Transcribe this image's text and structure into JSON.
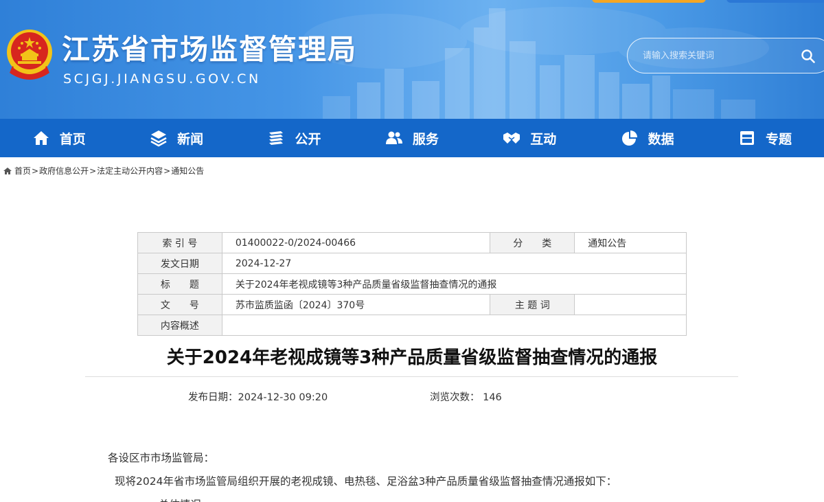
{
  "header": {
    "title": "江苏省市场监督管理局",
    "url": "SCJGJ.JIANGSU.GOV.CN",
    "search": {
      "placeholder": "请输入搜索关键词"
    }
  },
  "nav": {
    "items": [
      {
        "label": "首页",
        "icon": "home-icon"
      },
      {
        "label": "新闻",
        "icon": "layers-icon"
      },
      {
        "label": "公开",
        "icon": "books-icon"
      },
      {
        "label": "服务",
        "icon": "people-icon"
      },
      {
        "label": "互动",
        "icon": "handshake-icon"
      },
      {
        "label": "数据",
        "icon": "pie-chart-icon"
      },
      {
        "label": "专题",
        "icon": "window-icon"
      }
    ]
  },
  "breadcrumb": {
    "items": [
      "首页",
      "政府信息公开",
      "法定主动公开内容",
      "通知公告"
    ],
    "separator": ">"
  },
  "info": {
    "index_label": "索 引 号",
    "index_value": "01400022-0/2024-00466",
    "category_label": "分　　类",
    "category_value": "通知公告",
    "date_label": "发文日期",
    "date_value": "2024-12-27",
    "title_label": "标　　题",
    "title_value": "关于2024年老视成镜等3种产品质量省级监督抽查情况的通报",
    "docno_label": "文　　号",
    "docno_value": "苏市监质监函〔2024〕370号",
    "keywords_label": "主 题 词",
    "keywords_value": "",
    "summary_label": "内容概述",
    "summary_value": ""
  },
  "article": {
    "title": "关于2024年老视成镜等3种产品质量省级监督抽查情况的通报",
    "publish_label": "发布日期：",
    "publish_value": "2024-12-30 09:20",
    "views_label": "浏览次数：",
    "views_value": "146",
    "paragraphs": [
      "各设区市市场监管局：",
      "现将2024年省市场监管局组织开展的老视成镜、电热毯、足浴盆3种产品质量省级监督抽查情况通报如下：",
      "一、总体情况"
    ]
  },
  "colors": {
    "nav_bg": "#1467c9",
    "header_bg": "#4595e6",
    "table_label_bg": "#f2f2f2",
    "emblem_red": "#d7261e",
    "emblem_gold": "#f2c318"
  }
}
